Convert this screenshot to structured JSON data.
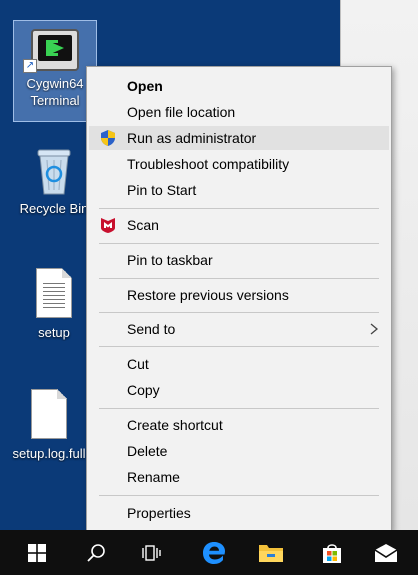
{
  "desktop": {
    "icons": [
      {
        "label_line1": "Cygwin64",
        "label_line2": "Terminal",
        "icon": "terminal-icon"
      },
      {
        "label": "Recycle Bin",
        "icon": "recycle-bin-icon"
      },
      {
        "label": "setup",
        "icon": "document-icon"
      },
      {
        "label": "setup.log.full",
        "icon": "blank-file-icon"
      }
    ],
    "background_color": "#0b3a78"
  },
  "context_menu": {
    "items": [
      {
        "label": "Open",
        "bold": true
      },
      {
        "label": "Open file location"
      },
      {
        "label": "Run as administrator",
        "icon": "uac-shield-icon",
        "highlighted": true
      },
      {
        "label": "Troubleshoot compatibility"
      },
      {
        "label": "Pin to Start"
      },
      {
        "label": "Scan",
        "icon": "mcafee-icon"
      },
      {
        "label": "Pin to taskbar"
      },
      {
        "label": "Restore previous versions"
      },
      {
        "label": "Send to",
        "submenu": true
      },
      {
        "label": "Cut"
      },
      {
        "label": "Copy"
      },
      {
        "label": "Create shortcut"
      },
      {
        "label": "Delete"
      },
      {
        "label": "Rename"
      },
      {
        "label": "Properties"
      }
    ]
  },
  "taskbar": {
    "items": [
      "windows-start-icon",
      "search-icon",
      "task-view-icon",
      "edge-icon",
      "file-explorer-icon",
      "store-icon",
      "mail-icon"
    ]
  }
}
